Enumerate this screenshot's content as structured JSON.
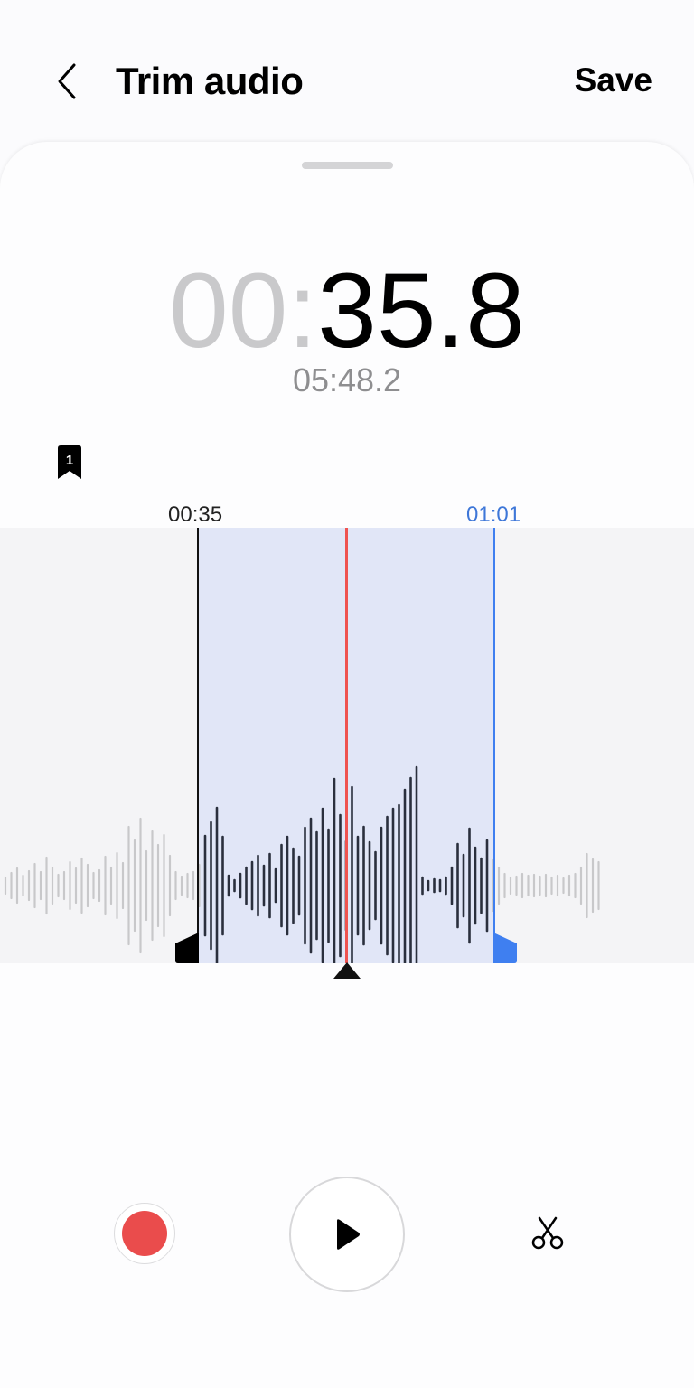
{
  "header": {
    "title": "Trim audio",
    "save_label": "Save",
    "back_icon": "chevron-left-icon"
  },
  "timer": {
    "minutes": "00",
    "separator": ":",
    "seconds": "35.8",
    "total_duration": "05:48.2"
  },
  "bookmark": {
    "number": "1"
  },
  "trim": {
    "start_label": "00:35",
    "end_label": "01:01"
  },
  "colors": {
    "accent_blue": "#3f7ff0",
    "playhead_red": "#ef5350",
    "record_red": "#ea4c4c",
    "selection_fill": "#e1e6f7"
  },
  "controls": {
    "record_icon": "record-icon",
    "play_icon": "play-icon",
    "trim_icon": "scissors-icon"
  }
}
